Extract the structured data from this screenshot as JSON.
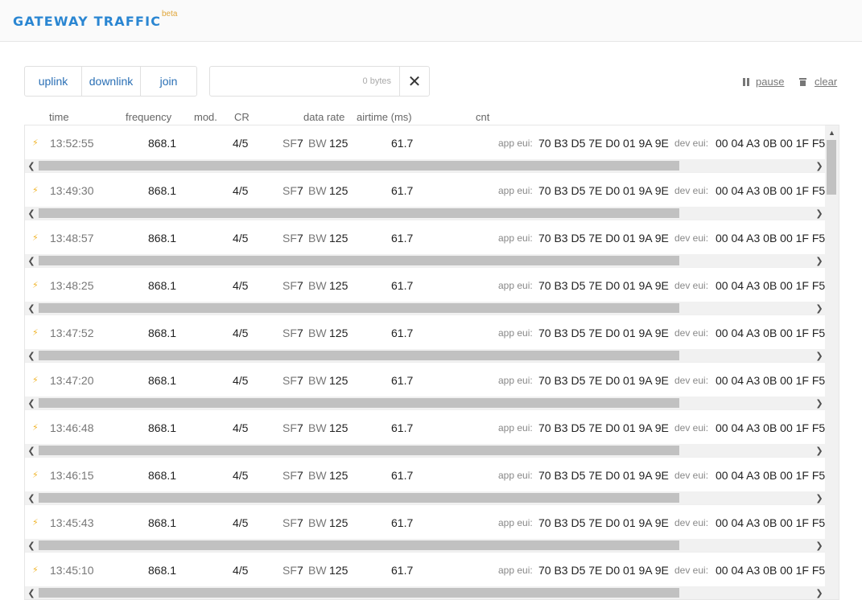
{
  "header": {
    "title": "GATEWAY TRAFFIC",
    "badge": "beta"
  },
  "filters": {
    "uplink": "uplink",
    "downlink": "downlink",
    "join": "join"
  },
  "search": {
    "bytes": "0 bytes",
    "clear_glyph": "✕"
  },
  "actions": {
    "pause": "pause",
    "clear": "clear"
  },
  "columns": {
    "time": "time",
    "frequency": "frequency",
    "mod": "mod.",
    "cr": "CR",
    "data_rate": "data rate",
    "airtime": "airtime (ms)",
    "cnt": "cnt"
  },
  "labels": {
    "sf": "SF",
    "bw": "BW",
    "app_eui": "app eui:",
    "dev_eui": "dev eui:"
  },
  "rows": [
    {
      "time": "13:52:55",
      "frequency": "868.1",
      "cr": "4/5",
      "sf": "7",
      "bw": "125",
      "airtime": "61.7",
      "app_eui": "70 B3 D5 7E D0 01 9A 9E",
      "dev_eui": "00 04 A3 0B 00 1F F5"
    },
    {
      "time": "13:49:30",
      "frequency": "868.1",
      "cr": "4/5",
      "sf": "7",
      "bw": "125",
      "airtime": "61.7",
      "app_eui": "70 B3 D5 7E D0 01 9A 9E",
      "dev_eui": "00 04 A3 0B 00 1F F5"
    },
    {
      "time": "13:48:57",
      "frequency": "868.1",
      "cr": "4/5",
      "sf": "7",
      "bw": "125",
      "airtime": "61.7",
      "app_eui": "70 B3 D5 7E D0 01 9A 9E",
      "dev_eui": "00 04 A3 0B 00 1F F5"
    },
    {
      "time": "13:48:25",
      "frequency": "868.1",
      "cr": "4/5",
      "sf": "7",
      "bw": "125",
      "airtime": "61.7",
      "app_eui": "70 B3 D5 7E D0 01 9A 9E",
      "dev_eui": "00 04 A3 0B 00 1F F5"
    },
    {
      "time": "13:47:52",
      "frequency": "868.1",
      "cr": "4/5",
      "sf": "7",
      "bw": "125",
      "airtime": "61.7",
      "app_eui": "70 B3 D5 7E D0 01 9A 9E",
      "dev_eui": "00 04 A3 0B 00 1F F5"
    },
    {
      "time": "13:47:20",
      "frequency": "868.1",
      "cr": "4/5",
      "sf": "7",
      "bw": "125",
      "airtime": "61.7",
      "app_eui": "70 B3 D5 7E D0 01 9A 9E",
      "dev_eui": "00 04 A3 0B 00 1F F5"
    },
    {
      "time": "13:46:48",
      "frequency": "868.1",
      "cr": "4/5",
      "sf": "7",
      "bw": "125",
      "airtime": "61.7",
      "app_eui": "70 B3 D5 7E D0 01 9A 9E",
      "dev_eui": "00 04 A3 0B 00 1F F5"
    },
    {
      "time": "13:46:15",
      "frequency": "868.1",
      "cr": "4/5",
      "sf": "7",
      "bw": "125",
      "airtime": "61.7",
      "app_eui": "70 B3 D5 7E D0 01 9A 9E",
      "dev_eui": "00 04 A3 0B 00 1F F5"
    },
    {
      "time": "13:45:43",
      "frequency": "868.1",
      "cr": "4/5",
      "sf": "7",
      "bw": "125",
      "airtime": "61.7",
      "app_eui": "70 B3 D5 7E D0 01 9A 9E",
      "dev_eui": "00 04 A3 0B 00 1F F5"
    },
    {
      "time": "13:45:10",
      "frequency": "868.1",
      "cr": "4/5",
      "sf": "7",
      "bw": "125",
      "airtime": "61.7",
      "app_eui": "70 B3 D5 7E D0 01 9A 9E",
      "dev_eui": "00 04 A3 0B 00 1F F5"
    }
  ],
  "icons": {
    "uplink": "lightning-bolt-icon",
    "pause": "pause-icon",
    "clear": "trash-icon",
    "search_clear": "close-icon"
  },
  "colors": {
    "title": "#2a86d2",
    "beta": "#e0a63a",
    "link": "#2a6fb5",
    "bolt": "#f0b428"
  }
}
